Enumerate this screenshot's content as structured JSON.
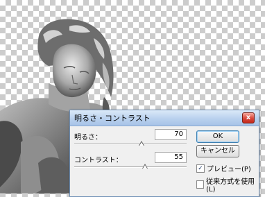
{
  "dialog": {
    "title": "明るさ・コントラスト",
    "close_glyph": "x",
    "brightness": {
      "label": "明るさ：",
      "value": "70",
      "slider_fraction": 0.6
    },
    "contrast": {
      "label": "コントラスト：",
      "value": "55",
      "slider_fraction": 0.63
    },
    "buttons": {
      "ok": "OK",
      "cancel": "キャンセル"
    },
    "checkboxes": {
      "preview": {
        "label": "プレビュー(P)",
        "checked": true,
        "mark": "✓"
      },
      "legacy": {
        "label": "従来方式を使用(L)",
        "checked": false,
        "mark": ""
      }
    }
  },
  "canvas": {
    "transparency_pattern": "checkerboard",
    "subject": "statue"
  }
}
